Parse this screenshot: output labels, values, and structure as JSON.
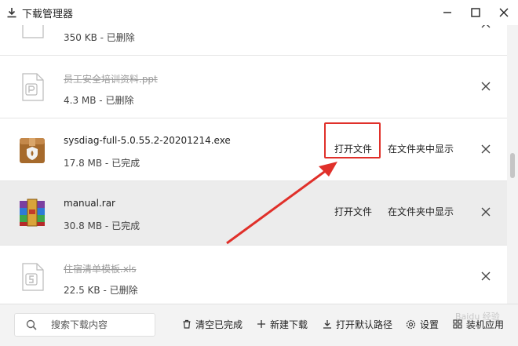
{
  "titlebar": {
    "title": "下载管理器"
  },
  "items": [
    {
      "name": "",
      "meta": "350 KB - 已删除",
      "deleted": true,
      "icon": "deleted-file-icon"
    },
    {
      "name": "员工安全培训资料.ppt",
      "meta": "4.3 MB - 已删除",
      "deleted": true,
      "icon": "ppt-file-icon"
    },
    {
      "name": "sysdiag-full-5.0.55.2-20201214.exe",
      "meta": "17.8 MB - 已完成",
      "deleted": false,
      "icon": "installer-package-icon",
      "open_label": "打开文件",
      "show_label": "在文件夹中显示"
    },
    {
      "name": "manual.rar",
      "meta": "30.8 MB - 已完成",
      "deleted": false,
      "icon": "winrar-archive-icon",
      "open_label": "打开文件",
      "show_label": "在文件夹中显示"
    },
    {
      "name": "住宿清单模板.xls",
      "meta": "22.5 KB - 已删除",
      "deleted": true,
      "icon": "xls-file-icon"
    }
  ],
  "bottom": {
    "search_placeholder": "搜索下载内容",
    "clear_label": "清空已完成",
    "new_label": "新建下载",
    "default_path_label": "打开默认路径",
    "settings_label": "设置",
    "apps_label": "装机应用"
  },
  "watermark": "Baidu 经验",
  "colors": {
    "highlight": "#e0302a",
    "selected_row": "#ececec"
  }
}
